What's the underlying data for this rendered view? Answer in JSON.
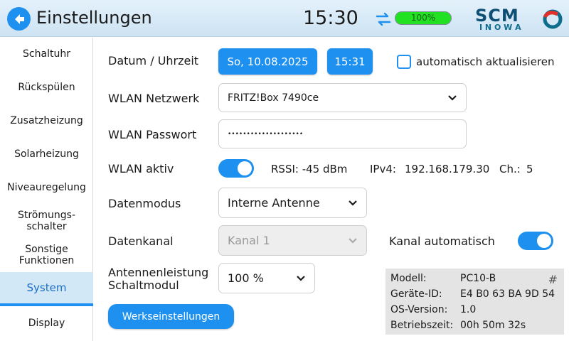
{
  "header": {
    "title": "Einstellungen",
    "clock": "15:30",
    "battery_label": "100%",
    "battery_level": 1.0,
    "accent_color": "#1e90f0"
  },
  "logo": {
    "main": "SCM",
    "sub": "I N O W A"
  },
  "sidebar": {
    "items": [
      {
        "label": "Schaltuhr"
      },
      {
        "label": "Rückspülen"
      },
      {
        "label": "Zusatzheizung"
      },
      {
        "label": "Solarheizung"
      },
      {
        "label": "Niveauregelung"
      },
      {
        "label": "Strömungs-\nschalter"
      },
      {
        "label": "Sonstige\nFunktionen"
      },
      {
        "label": "System",
        "active": true
      },
      {
        "label": "Display"
      }
    ]
  },
  "main": {
    "datetime_label": "Datum / Uhrzeit",
    "date_value": "So, 10.08.2025",
    "time_value": "15:31",
    "auto_update_label": "automatisch aktualisieren",
    "auto_update_checked": false,
    "wlan_network_label": "WLAN Netzwerk",
    "wlan_network_value": "FRITZ!Box 7490ce",
    "wlan_password_label": "WLAN Passwort",
    "wlan_password_value": "••••••••••••••••••••",
    "wlan_active_label": "WLAN aktiv",
    "wlan_active_on": true,
    "rssi": "RSSI: -45 dBm",
    "ipv4_label": "IPv4:",
    "ipv4_value": "192.168.179.30",
    "channel_label": "Ch.:",
    "channel_value": "5",
    "datamode_label": "Datenmodus",
    "datamode_value": "Interne Antenne",
    "datachannel_label": "Datenkanal",
    "datachannel_value": "Kanal 1",
    "channel_auto_label": "Kanal automatisch",
    "channel_auto_on": true,
    "antenna_power_label": "Antennenleistung\nSchaltmodul",
    "antenna_power_value": "100 %",
    "factory_reset_label": "Werkseinstellungen"
  },
  "infobox": {
    "hash": "#",
    "rows": [
      {
        "label": "Modell:",
        "value": "PC10-B"
      },
      {
        "label": "Geräte-ID:",
        "value": "E4 B0 63 BA 9D 54"
      },
      {
        "label": "OS-Version:",
        "value": "1.0"
      },
      {
        "label": "Betriebszeit:",
        "value": "00h 50m 32s"
      }
    ]
  }
}
